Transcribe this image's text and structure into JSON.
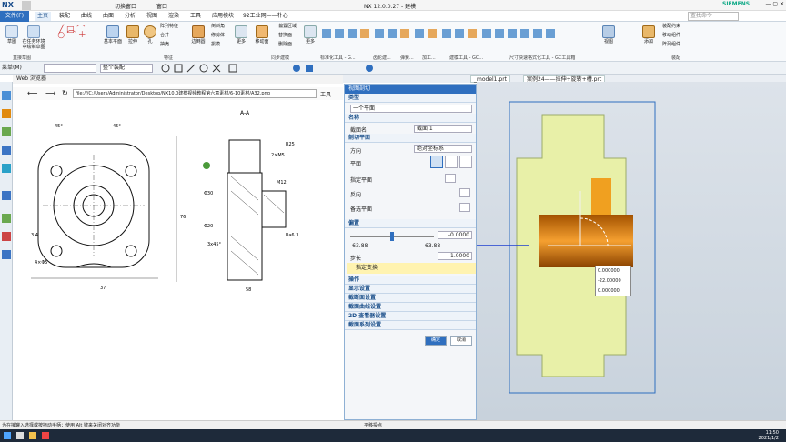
{
  "titlebar": {
    "brand": "NX",
    "file_menu": "文件(F)",
    "title": "NX 12.0.0.27 - 建模",
    "siemens": "SIEMENS",
    "search_placeholder": "查找命令",
    "window_menu": "窗口",
    "switch_window": "切换窗口"
  },
  "tabs": [
    "主页",
    "装配",
    "曲线",
    "曲面",
    "分析",
    "视图",
    "渲染",
    "工具",
    "应用模块",
    "92工业网——朴心"
  ],
  "ribbon": {
    "groups": [
      "直接草图",
      "特征",
      "同步建模",
      "标准化工具 - G...",
      "齿轮建...",
      "弹簧...",
      "加工...",
      "建模工具 - GC...",
      "尺寸快速格式化工具 - GC工具箱",
      "装配"
    ],
    "buttons": [
      "草图",
      "在任务环境中绘制草图",
      "基本平面",
      "拉伸",
      "孔",
      "阵列特征",
      "合并",
      "抽壳",
      "边倒圆",
      "倒斜角",
      "修剪体",
      "拔模",
      "偏置区域",
      "替换面",
      "删除面",
      "移动面",
      "更多",
      "更多",
      "视图",
      "添加",
      "装配约束",
      "移动组件",
      "阵列组件"
    ]
  },
  "menu": {
    "label": "菜单(M)",
    "filter": "整个装配"
  },
  "web": {
    "title": "Web 浏览器",
    "url": "file:///C:/Users/Administrator/Desktop/NX10.0建模视频教程第六章素材/6-10素材/A32.png",
    "tools": "工具"
  },
  "doctabs": [
    "_model1.prt",
    "案例24——拉伸+旋转+槽.prt"
  ],
  "panel": {
    "title": "视图剖切",
    "type_hdr": "类型",
    "type_val": "一个平面",
    "name_hdr": "名称",
    "name_lbl": "截面名",
    "name_val": "截面 1",
    "plane_hdr": "剖切平面",
    "dir_lbl": "方向",
    "dir_val": "绝对坐标系",
    "plane_lbl": "平面",
    "spec_lbl": "指定平面",
    "rev_lbl": "反向",
    "alt_lbl": "备选平面",
    "offset_hdr": "偏置",
    "offset_val": "-0.0000",
    "min": "-63.88",
    "max": "63.88",
    "step_lbl": "步长",
    "step_val": "1.0000",
    "transform": "指定变换",
    "sections": [
      "操作",
      "显示设置",
      "截断面设置",
      "截面曲线设置",
      "2D 查看器设置",
      "截面系列设置"
    ],
    "ok": "确定",
    "cancel": "取消"
  },
  "coords": {
    "x": "0.000000",
    "y": "-22.00000",
    "z": "0.000000"
  },
  "status": {
    "left": "为在接罐入选择或按拖动手柄；使用 Alt 键来关闭对齐功能",
    "mid": "平移投点"
  },
  "taskbar": {
    "time": "11:50",
    "date": "2021/1/2"
  },
  "drawing": {
    "section": "A-A",
    "dims": [
      "45°",
      "45°",
      "4×Φ5",
      "Φ30",
      "R25",
      "2×M5",
      "Φ20",
      "76",
      "37",
      "58",
      "Ra6.3",
      "3x45°",
      "M12",
      "3.4"
    ]
  },
  "colors": {
    "accent": "#2f6fbf",
    "part": "#e8f0a8",
    "cyl": "#e08a10"
  }
}
